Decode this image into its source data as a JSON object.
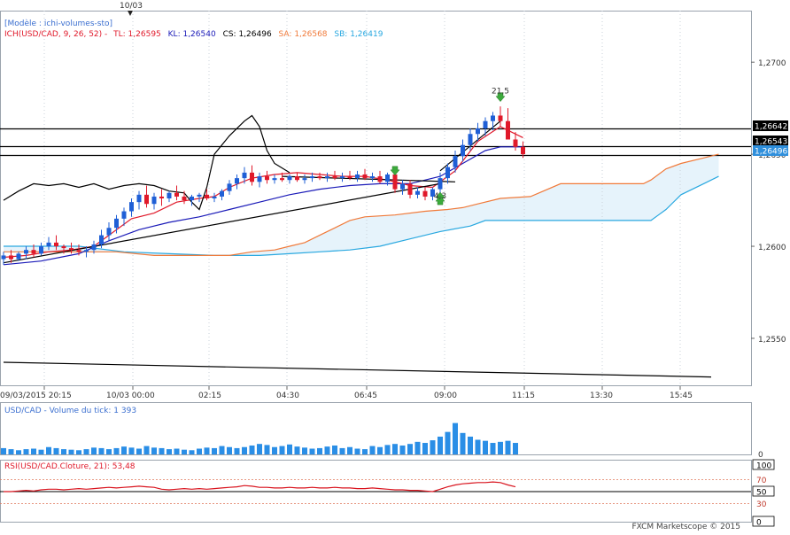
{
  "top_marker": {
    "label": "10/03"
  },
  "legend": {
    "model": "[Modèle : ichi-volumes-sto]",
    "ich_prefix": "ICH(USD/CAD, 9, 26, 52) -",
    "tl": "TL: 1,26595",
    "kl": "KL: 1,26540",
    "cs": "CS: 1,26496",
    "sa": "SA: 1,26568",
    "sb": "SB: 1,26419"
  },
  "colors": {
    "up": "#1f5fd6",
    "down": "#e0192a",
    "tenkan": "#e0192a",
    "kijun": "#1a1ab8",
    "chikou": "#000000",
    "senkou_a": "#f07a3a",
    "senkou_b": "#29a8e0",
    "cloud": "#e6f3fb",
    "volume": "#2a8ee6",
    "rsi": "#d9141e"
  },
  "chart_data": [
    {
      "type": "candlestick",
      "title": "USD/CAD",
      "x_labels": [
        "09/03/2015 20:15",
        "10/03 00:00",
        "02:15",
        "04:30",
        "06:45",
        "09:00",
        "11:15",
        "13:30",
        "15:45"
      ],
      "y_ticks": [
        "1,2700",
        "1,2650",
        "1,2600",
        "1,2550"
      ],
      "ylim": [
        1.2524,
        1.2728
      ],
      "price_tags": [
        {
          "label": "1,26642",
          "value": 1.26642
        },
        {
          "label": "1,26543",
          "value": 1.26543
        },
        {
          "label": "1,26496",
          "value": 1.26496
        }
      ],
      "annotations": [
        {
          "text": "21,5",
          "at_candle": 66,
          "value": 1.2683
        },
        {
          "text": "4,3",
          "at_candle": 58,
          "value": 1.2626
        }
      ],
      "candles": [
        [
          1.2593,
          1.2597,
          1.259,
          1.2595
        ],
        [
          1.2595,
          1.2598,
          1.2591,
          1.2593
        ],
        [
          1.2593,
          1.2597,
          1.2592,
          1.2596
        ],
        [
          1.2596,
          1.26,
          1.2593,
          1.2598
        ],
        [
          1.2598,
          1.2601,
          1.2594,
          1.2596
        ],
        [
          1.2596,
          1.2602,
          1.2595,
          1.26
        ],
        [
          1.26,
          1.2605,
          1.2598,
          1.2602
        ],
        [
          1.2602,
          1.2606,
          1.2598,
          1.26
        ],
        [
          1.26,
          1.2601,
          1.2596,
          1.2599
        ],
        [
          1.2599,
          1.2602,
          1.2596,
          1.2598
        ],
        [
          1.2598,
          1.2601,
          1.2595,
          1.2597
        ],
        [
          1.2597,
          1.26,
          1.2594,
          1.2598
        ],
        [
          1.2598,
          1.2603,
          1.2596,
          1.2601
        ],
        [
          1.2601,
          1.2609,
          1.2599,
          1.2606
        ],
        [
          1.2606,
          1.2613,
          1.2603,
          1.261
        ],
        [
          1.261,
          1.2617,
          1.2607,
          1.2615
        ],
        [
          1.2615,
          1.2621,
          1.2611,
          1.2619
        ],
        [
          1.2619,
          1.2626,
          1.2616,
          1.2624
        ],
        [
          1.2624,
          1.263,
          1.262,
          1.2628
        ],
        [
          1.2628,
          1.2633,
          1.2621,
          1.2623
        ],
        [
          1.2623,
          1.2629,
          1.262,
          1.2627
        ],
        [
          1.2627,
          1.2631,
          1.2622,
          1.2626
        ],
        [
          1.2626,
          1.263,
          1.2624,
          1.2629
        ],
        [
          1.2629,
          1.2633,
          1.2625,
          1.2627
        ],
        [
          1.2627,
          1.263,
          1.2623,
          1.2625
        ],
        [
          1.2625,
          1.2628,
          1.2622,
          1.2627
        ],
        [
          1.2627,
          1.2629,
          1.2624,
          1.2628
        ],
        [
          1.2628,
          1.2631,
          1.2625,
          1.2626
        ],
        [
          1.2626,
          1.2629,
          1.2624,
          1.2627
        ],
        [
          1.2627,
          1.2631,
          1.2625,
          1.263
        ],
        [
          1.263,
          1.2636,
          1.2628,
          1.2634
        ],
        [
          1.2634,
          1.2639,
          1.2631,
          1.2637
        ],
        [
          1.2637,
          1.2643,
          1.2634,
          1.264
        ],
        [
          1.264,
          1.2644,
          1.2633,
          1.2635
        ],
        [
          1.2635,
          1.264,
          1.2632,
          1.2638
        ],
        [
          1.2638,
          1.2641,
          1.2634,
          1.2636
        ],
        [
          1.2636,
          1.2639,
          1.2634,
          1.2637
        ],
        [
          1.2637,
          1.264,
          1.2635,
          1.2636
        ],
        [
          1.2636,
          1.2639,
          1.2634,
          1.2638
        ],
        [
          1.2638,
          1.264,
          1.2635,
          1.2636
        ],
        [
          1.2636,
          1.2639,
          1.2634,
          1.2637
        ],
        [
          1.2637,
          1.264,
          1.2635,
          1.2638
        ],
        [
          1.2638,
          1.264,
          1.2636,
          1.2637
        ],
        [
          1.2637,
          1.264,
          1.2635,
          1.2638
        ],
        [
          1.2638,
          1.2641,
          1.2636,
          1.2637
        ],
        [
          1.2637,
          1.264,
          1.2635,
          1.2638
        ],
        [
          1.2638,
          1.2641,
          1.2636,
          1.2637
        ],
        [
          1.2637,
          1.2641,
          1.2635,
          1.2639
        ],
        [
          1.2639,
          1.2642,
          1.2636,
          1.2637
        ],
        [
          1.2637,
          1.264,
          1.2635,
          1.2638
        ],
        [
          1.2638,
          1.2641,
          1.2634,
          1.2635
        ],
        [
          1.2635,
          1.264,
          1.2633,
          1.2639
        ],
        [
          1.2639,
          1.2641,
          1.2629,
          1.2631
        ],
        [
          1.2631,
          1.2636,
          1.2628,
          1.2634
        ],
        [
          1.2634,
          1.2636,
          1.2626,
          1.2628
        ],
        [
          1.2628,
          1.2632,
          1.2626,
          1.263
        ],
        [
          1.263,
          1.2632,
          1.2625,
          1.2627
        ],
        [
          1.2627,
          1.2632,
          1.2625,
          1.2631
        ],
        [
          1.2631,
          1.264,
          1.2627,
          1.2637
        ],
        [
          1.2637,
          1.2645,
          1.2634,
          1.2643
        ],
        [
          1.2643,
          1.2652,
          1.264,
          1.2649
        ],
        [
          1.2649,
          1.2658,
          1.2646,
          1.2655
        ],
        [
          1.2655,
          1.2664,
          1.2652,
          1.2661
        ],
        [
          1.2661,
          1.2667,
          1.2657,
          1.2664
        ],
        [
          1.2664,
          1.267,
          1.266,
          1.2668
        ],
        [
          1.2668,
          1.2673,
          1.2663,
          1.2671
        ],
        [
          1.2671,
          1.2676,
          1.2665,
          1.2668
        ],
        [
          1.2668,
          1.2675,
          1.266,
          1.2658
        ],
        [
          1.2658,
          1.2662,
          1.2652,
          1.2654
        ],
        [
          1.2654,
          1.2657,
          1.2648,
          1.265
        ]
      ],
      "tenkan": [
        [
          0,
          1.2594
        ],
        [
          3,
          1.2595
        ],
        [
          6,
          1.2597
        ],
        [
          9,
          1.2598
        ],
        [
          12,
          1.26
        ],
        [
          14,
          1.2606
        ],
        [
          17,
          1.2615
        ],
        [
          20,
          1.2618
        ],
        [
          23,
          1.2624
        ],
        [
          26,
          1.2626
        ],
        [
          28,
          1.2627
        ],
        [
          30,
          1.2632
        ],
        [
          33,
          1.2637
        ],
        [
          36,
          1.2639
        ],
        [
          39,
          1.264
        ],
        [
          42,
          1.2639
        ],
        [
          45,
          1.2638
        ],
        [
          48,
          1.2638
        ],
        [
          51,
          1.2636
        ],
        [
          54,
          1.2633
        ],
        [
          57,
          1.2632
        ],
        [
          60,
          1.2641
        ],
        [
          63,
          1.2657
        ],
        [
          66,
          1.2665
        ],
        [
          69,
          1.2659
        ]
      ],
      "kijun": [
        [
          0,
          1.259
        ],
        [
          5,
          1.2592
        ],
        [
          10,
          1.2596
        ],
        [
          14,
          1.2603
        ],
        [
          18,
          1.2609
        ],
        [
          22,
          1.2613
        ],
        [
          26,
          1.2616
        ],
        [
          30,
          1.262
        ],
        [
          34,
          1.2624
        ],
        [
          38,
          1.2628
        ],
        [
          42,
          1.2631
        ],
        [
          46,
          1.2633
        ],
        [
          50,
          1.2634
        ],
        [
          54,
          1.2634
        ],
        [
          58,
          1.2638
        ],
        [
          61,
          1.2645
        ],
        [
          64,
          1.2652
        ],
        [
          66,
          1.2654
        ],
        [
          69,
          1.2654
        ]
      ],
      "chikou": [
        [
          0,
          1.2625
        ],
        [
          2,
          1.263
        ],
        [
          4,
          1.2634
        ],
        [
          6,
          1.2633
        ],
        [
          8,
          1.2634
        ],
        [
          10,
          1.2632
        ],
        [
          12,
          1.2634
        ],
        [
          14,
          1.2631
        ],
        [
          16,
          1.2633
        ],
        [
          18,
          1.2634
        ],
        [
          20,
          1.2633
        ],
        [
          22,
          1.263
        ],
        [
          24,
          1.2629
        ],
        [
          25,
          1.2624
        ],
        [
          26,
          1.262
        ],
        [
          27,
          1.2632
        ],
        [
          28,
          1.265
        ],
        [
          30,
          1.266
        ],
        [
          32,
          1.2668
        ],
        [
          33,
          1.2671
        ],
        [
          34,
          1.2665
        ],
        [
          35,
          1.2652
        ],
        [
          36,
          1.2645
        ],
        [
          38,
          1.264
        ]
      ],
      "senkou_a": [
        [
          0,
          1.2597
        ],
        [
          5,
          1.2597
        ],
        [
          10,
          1.2597
        ],
        [
          15,
          1.2597
        ],
        [
          20,
          1.2595
        ],
        [
          25,
          1.2595
        ],
        [
          30,
          1.2595
        ],
        [
          33,
          1.2597
        ],
        [
          36,
          1.2598
        ],
        [
          38,
          1.26
        ],
        [
          40,
          1.2602
        ],
        [
          42,
          1.2606
        ],
        [
          44,
          1.261
        ],
        [
          46,
          1.2614
        ],
        [
          48,
          1.2616
        ],
        [
          52,
          1.2617
        ],
        [
          56,
          1.2619
        ],
        [
          59,
          1.262
        ],
        [
          61,
          1.2621
        ],
        [
          63,
          1.2623
        ],
        [
          66,
          1.2626
        ],
        [
          70,
          1.2627
        ],
        [
          74,
          1.2634
        ],
        [
          80,
          1.2634
        ],
        [
          85,
          1.2634
        ],
        [
          86,
          1.2636
        ],
        [
          88,
          1.2642
        ],
        [
          90,
          1.2645
        ],
        [
          93,
          1.2648
        ],
        [
          95,
          1.265
        ]
      ],
      "senkou_b": [
        [
          0,
          1.26
        ],
        [
          10,
          1.26
        ],
        [
          16,
          1.2597
        ],
        [
          22,
          1.2596
        ],
        [
          28,
          1.2595
        ],
        [
          34,
          1.2595
        ],
        [
          38,
          1.2596
        ],
        [
          42,
          1.2597
        ],
        [
          46,
          1.2598
        ],
        [
          50,
          1.26
        ],
        [
          54,
          1.2604
        ],
        [
          58,
          1.2608
        ],
        [
          62,
          1.2611
        ],
        [
          64,
          1.2614
        ],
        [
          78,
          1.2614
        ],
        [
          86,
          1.2614
        ],
        [
          87,
          1.2617
        ],
        [
          88,
          1.262
        ],
        [
          90,
          1.2628
        ],
        [
          93,
          1.2634
        ],
        [
          95,
          1.2638
        ]
      ],
      "trendlines": [
        [
          [
            0,
            1.2591
          ],
          [
            58,
            1.2634
          ]
        ],
        [
          [
            37,
            1.2638
          ],
          [
            60,
            1.2635
          ]
        ],
        [
          [
            58,
            1.2641
          ],
          [
            66,
            1.2668
          ]
        ],
        [
          [
            0,
            1.2537
          ],
          [
            94,
            1.2529
          ]
        ]
      ],
      "arrows": [
        {
          "at_candle": 52,
          "value": 1.2641,
          "dir": "down"
        },
        {
          "at_candle": 58,
          "value": 1.2627,
          "dir": "up"
        },
        {
          "at_candle": 58,
          "value": 1.2625,
          "dir": "up"
        },
        {
          "at_candle": 66,
          "value": 1.2681,
          "dir": "down"
        }
      ]
    },
    {
      "type": "bar",
      "title": "USD/CAD - Volume du tick: 1 393",
      "ylim": [
        0,
        100
      ],
      "y_ticks": [
        "0"
      ],
      "values": [
        12,
        10,
        8,
        10,
        11,
        9,
        14,
        12,
        10,
        9,
        8,
        10,
        13,
        12,
        10,
        12,
        15,
        13,
        11,
        16,
        13,
        12,
        10,
        11,
        9,
        8,
        11,
        13,
        12,
        16,
        14,
        12,
        14,
        17,
        20,
        18,
        14,
        16,
        19,
        15,
        13,
        11,
        12,
        15,
        17,
        12,
        14,
        11,
        10,
        16,
        14,
        18,
        20,
        17,
        20,
        24,
        22,
        27,
        34,
        43,
        60,
        41,
        34,
        28,
        26,
        22,
        24,
        26,
        22
      ]
    },
    {
      "type": "line",
      "title": "RSI(USD/CAD.Cloture, 21): 53,48",
      "ylim": [
        0,
        100
      ],
      "y_ticks": [
        "100",
        "70",
        "50",
        "30",
        "0"
      ],
      "levels": [
        70,
        50,
        30
      ],
      "values": [
        50,
        50,
        51,
        52,
        51,
        53,
        54,
        54,
        53,
        54,
        55,
        54,
        55,
        56,
        57,
        56,
        57,
        58,
        59,
        58,
        57,
        54,
        53,
        54,
        55,
        54,
        55,
        54,
        55,
        56,
        57,
        58,
        60,
        59,
        57,
        57,
        56,
        56,
        57,
        56,
        56,
        57,
        56,
        56,
        57,
        56,
        56,
        55,
        55,
        56,
        55,
        54,
        53,
        53,
        52,
        52,
        51,
        50,
        54,
        58,
        61,
        63,
        64,
        65,
        65,
        66,
        65,
        61,
        58
      ]
    }
  ],
  "footer": {
    "copyright": "FXCM Marketscope © 2015"
  }
}
